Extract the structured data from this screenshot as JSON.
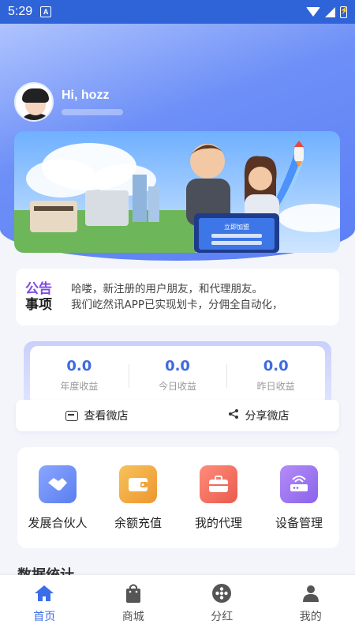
{
  "status_bar": {
    "time": "5:29",
    "app_icon": "A"
  },
  "user": {
    "greeting": "Hi, hozz"
  },
  "banner": {
    "screen_label": "立即加盟"
  },
  "notice": {
    "title_line1": "公告",
    "title_line2": "事项",
    "text_line1": "哈喽，新注册的用户朋友，和代理朋友。",
    "text_line2": "我们屹然讯APP已实现划卡，分佣全自动化，"
  },
  "stats": [
    {
      "value": "0.0",
      "label": "年度收益"
    },
    {
      "value": "0.0",
      "label": "今日收益"
    },
    {
      "value": "0.0",
      "label": "昨日收益"
    }
  ],
  "shop_actions": [
    {
      "label": "查看微店",
      "icon": "shop-icon"
    },
    {
      "label": "分享微店",
      "icon": "share-icon"
    }
  ],
  "menu": [
    {
      "label": "发展合伙人",
      "icon": "handshake-icon",
      "color": "#6f8cf5"
    },
    {
      "label": "余额充值",
      "icon": "wallet-icon",
      "color": "#f2a33a"
    },
    {
      "label": "我的代理",
      "icon": "briefcase-icon",
      "color": "#ef6a5c"
    },
    {
      "label": "设备管理",
      "icon": "router-icon",
      "color": "#9b6ef0"
    }
  ],
  "section_title": "数据统计",
  "tabs": [
    {
      "label": "首页",
      "icon": "home-icon",
      "active": true
    },
    {
      "label": "商城",
      "icon": "shopping-bag-icon",
      "active": false
    },
    {
      "label": "分红",
      "icon": "bonus-icon",
      "active": false
    },
    {
      "label": "我的",
      "icon": "user-icon",
      "active": false
    }
  ],
  "colors": {
    "accent": "#3a6ee8",
    "stat_value": "#3f6be0",
    "status_bar": "#2f63d8"
  }
}
